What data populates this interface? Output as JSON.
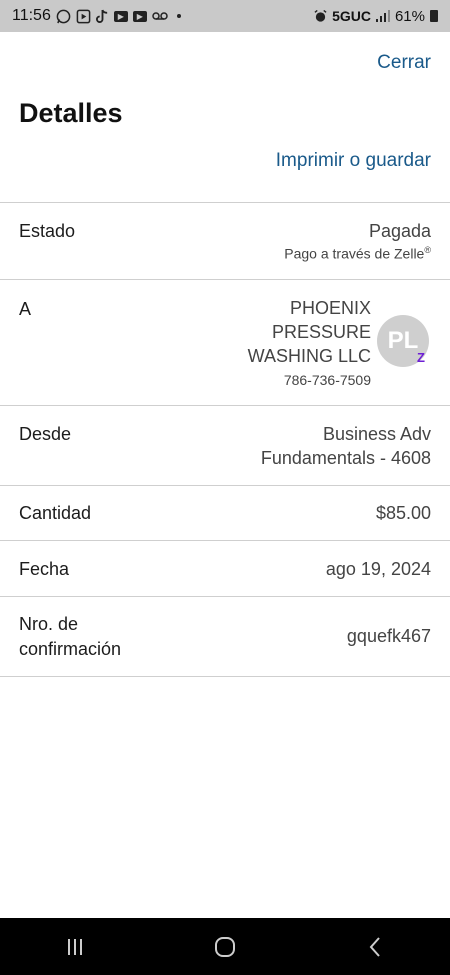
{
  "statusbar": {
    "time": "11:56",
    "network": "5GUC",
    "battery": "61%"
  },
  "header": {
    "close_label": "Cerrar",
    "title": "Detalles",
    "print_label": "Imprimir o guardar"
  },
  "details": {
    "estado": {
      "label": "Estado",
      "value": "Pagada",
      "sub": "Pago a través de Zelle",
      "sub_mark": "®"
    },
    "a": {
      "label": "A",
      "name": "PHOENIX PRESSURE WASHING LLC",
      "phone": "786-736-7509",
      "avatar_initials": "PL",
      "badge": "Z"
    },
    "desde": {
      "label": "Desde",
      "value_line1": "Business Adv",
      "value_line2": "Fundamentals - 4608"
    },
    "cantidad": {
      "label": "Cantidad",
      "value": "$85.00"
    },
    "fecha": {
      "label": "Fecha",
      "value": "ago 19, 2024"
    },
    "confirmacion": {
      "label_line1": "Nro. de",
      "label_line2": "confirmación",
      "value": "gquefk467"
    }
  },
  "colors": {
    "link": "#1a5a8a",
    "zelle": "#6d1ed4",
    "statusbar": "#c9c9c9",
    "navbar": "#000000"
  }
}
